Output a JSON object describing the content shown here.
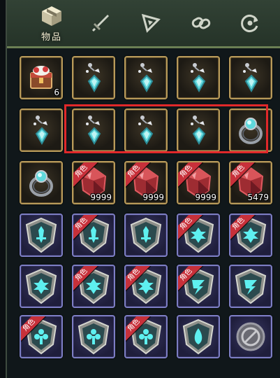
{
  "tabs": [
    {
      "label": "物品",
      "icon": "bag-cube-icon",
      "active": true
    },
    {
      "label": "",
      "icon": "sword-icon",
      "active": false
    },
    {
      "label": "",
      "icon": "triangle-pen-icon",
      "active": false
    },
    {
      "label": "",
      "icon": "link-chain-icon",
      "active": false
    },
    {
      "label": "",
      "icon": "refresh-arrows-icon",
      "active": false
    }
  ],
  "ribbon_text": "角色",
  "colors": {
    "highlight": "#e0282a",
    "gold_border": "#b89a5a",
    "blue_border": "#7d7ec4",
    "ribbon": "#c7303a"
  },
  "grid": [
    [
      {
        "item": "treasure-box",
        "frame": "gold",
        "count": "6",
        "ribbon": false
      },
      {
        "item": "earring",
        "frame": "gold",
        "count": "",
        "ribbon": false
      },
      {
        "item": "earring",
        "frame": "gold",
        "count": "",
        "ribbon": false
      },
      {
        "item": "earring",
        "frame": "gold",
        "count": "",
        "ribbon": false
      },
      {
        "item": "earring",
        "frame": "gold",
        "count": "",
        "ribbon": false
      }
    ],
    [
      {
        "item": "earring",
        "frame": "gold",
        "count": "",
        "ribbon": false
      },
      {
        "item": "earring",
        "frame": "gold",
        "count": "",
        "ribbon": false
      },
      {
        "item": "earring",
        "frame": "gold",
        "count": "",
        "ribbon": false
      },
      {
        "item": "earring",
        "frame": "gold",
        "count": "",
        "ribbon": false
      },
      {
        "item": "ring",
        "frame": "gold",
        "count": "",
        "ribbon": false
      }
    ],
    [
      {
        "item": "ring",
        "frame": "gold",
        "count": "",
        "ribbon": false
      },
      {
        "item": "red-crystal",
        "frame": "gold",
        "count": "9999",
        "ribbon": true
      },
      {
        "item": "red-crystal",
        "frame": "gold",
        "count": "9999",
        "ribbon": true
      },
      {
        "item": "red-crystal",
        "frame": "gold",
        "count": "9999",
        "ribbon": true
      },
      {
        "item": "red-crystal",
        "frame": "gold",
        "count": "5479",
        "ribbon": true
      }
    ],
    [
      {
        "item": "emblem-sword",
        "frame": "blue",
        "count": "",
        "ribbon": false
      },
      {
        "item": "emblem-sword",
        "frame": "blue",
        "count": "",
        "ribbon": true
      },
      {
        "item": "emblem-sword",
        "frame": "blue",
        "count": "",
        "ribbon": false
      },
      {
        "item": "emblem-cross",
        "frame": "blue",
        "count": "",
        "ribbon": true
      },
      {
        "item": "emblem-cross",
        "frame": "blue",
        "count": "",
        "ribbon": true
      }
    ],
    [
      {
        "item": "emblem-cross",
        "frame": "blue",
        "count": "",
        "ribbon": false
      },
      {
        "item": "emblem-cross",
        "frame": "blue",
        "count": "",
        "ribbon": true
      },
      {
        "item": "emblem-cross",
        "frame": "blue",
        "count": "",
        "ribbon": true
      },
      {
        "item": "emblem-bolt",
        "frame": "blue",
        "count": "",
        "ribbon": true
      },
      {
        "item": "emblem-bolt",
        "frame": "blue",
        "count": "",
        "ribbon": false
      }
    ],
    [
      {
        "item": "emblem-flower",
        "frame": "blue",
        "count": "",
        "ribbon": true
      },
      {
        "item": "emblem-flower",
        "frame": "blue",
        "count": "",
        "ribbon": false
      },
      {
        "item": "emblem-flower",
        "frame": "blue",
        "count": "",
        "ribbon": true
      },
      {
        "item": "emblem-drop",
        "frame": "blue",
        "count": "",
        "ribbon": false
      },
      {
        "item": "locked-slot",
        "frame": "blue",
        "count": "",
        "ribbon": false
      }
    ]
  ]
}
